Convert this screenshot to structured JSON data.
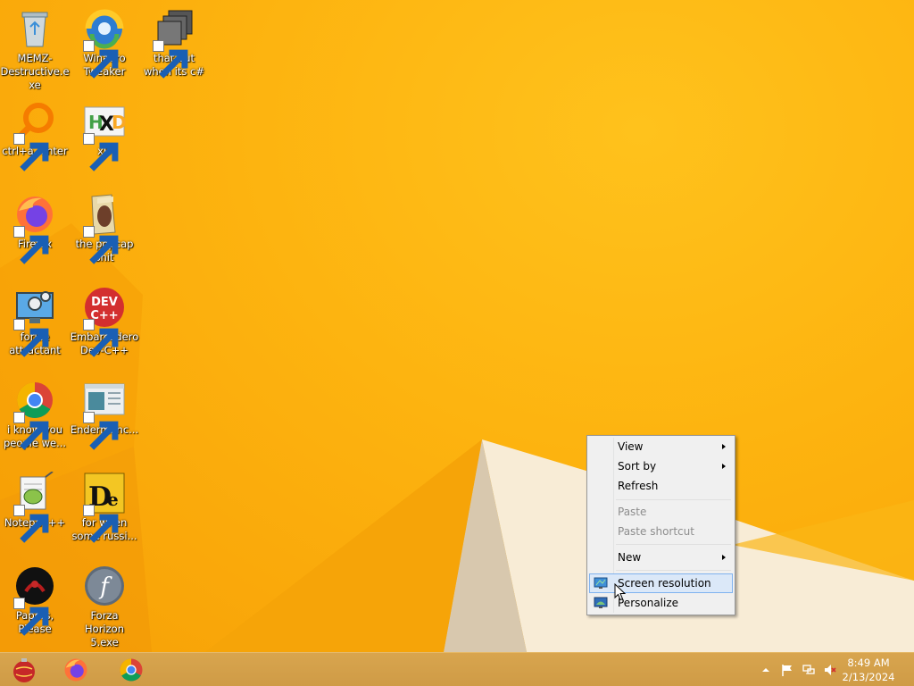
{
  "desktop": {
    "icons": [
      {
        "label": "MEMZ-Destructive.exe",
        "icon": "recycle-bin-icon"
      },
      {
        "label": "Winaero Tweaker",
        "icon": "winaero-tweaker-icon"
      },
      {
        "label": "that but when its c#",
        "icon": "stacked-windows-icon"
      },
      {
        "label": "ctrl+a, enter",
        "icon": "magnifier-app-icon"
      },
      {
        "label": "xD",
        "icon": "hxd-hex-editor-icon"
      },
      {
        "label": "Firefox",
        "icon": "firefox-icon"
      },
      {
        "label": "the popcap shit",
        "icon": "folder-icon"
      },
      {
        "label": "forkie attractant",
        "icon": "monitor-settings-icon"
      },
      {
        "label": "Embarcadero Dev-C++",
        "icon": "devcpp-icon"
      },
      {
        "label": "i know you people we...",
        "icon": "chrome-icon"
      },
      {
        "label": "Endermanc...",
        "icon": "window-document-icon"
      },
      {
        "label": "Notepad++",
        "icon": "notepadpp-icon"
      },
      {
        "label": "for when some russi...",
        "icon": "de-app-icon"
      },
      {
        "label": "Papers, Please",
        "icon": "papers-please-icon"
      },
      {
        "label": "Forza Horizon 5.exe",
        "icon": "flash-player-icon"
      }
    ]
  },
  "context_menu": {
    "items": {
      "view": "View",
      "sort_by": "Sort by",
      "refresh": "Refresh",
      "paste": "Paste",
      "paste_shortcut": "Paste shortcut",
      "new": "New",
      "screen_resolution": "Screen resolution",
      "personalize": "Personalize"
    },
    "highlighted": "screen_resolution",
    "disabled": [
      "paste",
      "paste_shortcut"
    ]
  },
  "taskbar": {
    "pinned": [
      "ornament-app-icon",
      "firefox-icon",
      "chrome-icon"
    ],
    "tray": [
      "show-hidden-icons-chevron",
      "action-center-flag-icon",
      "network-icon",
      "volume-muted-icon"
    ],
    "clock": {
      "time": "8:49 AM",
      "date": "2/13/2024"
    }
  },
  "colors": {
    "wallpaper": "#fdb30f",
    "taskbar": "#d4a14a",
    "menu_highlight": "#dbe8f8",
    "menu_highlight_border": "#7fb2ef"
  }
}
